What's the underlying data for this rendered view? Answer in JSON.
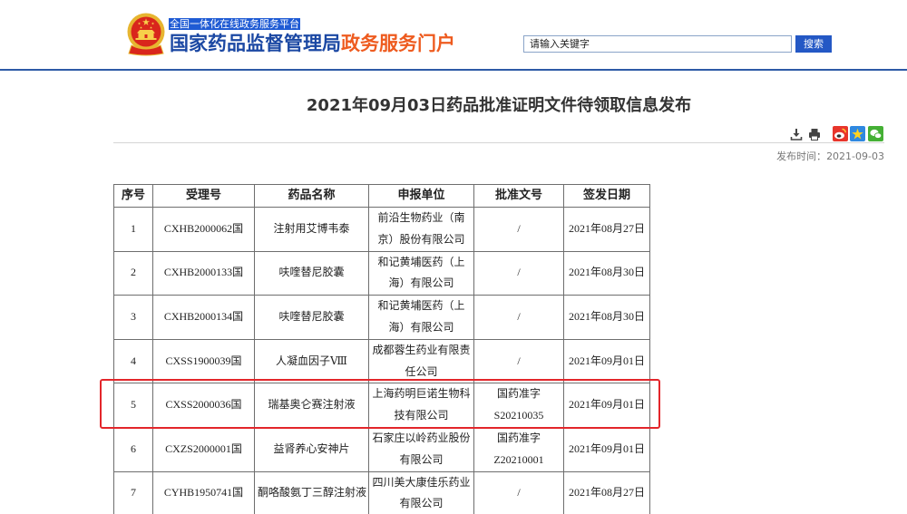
{
  "header": {
    "logo_icon": "national-emblem-icon",
    "platform_tag": "全国一体化在线政务服务平台",
    "title_main": "国家药品监督管理局",
    "title_suffix": "政务服务门户"
  },
  "search": {
    "placeholder": "请输入关键字",
    "button_label": "搜索"
  },
  "article": {
    "title": "2021年09月03日药品批准证明文件待领取信息发布",
    "tool_icons": [
      "download-icon",
      "print-icon"
    ],
    "share_icons": [
      "weibo-icon",
      "qzone-icon",
      "wechat-icon"
    ],
    "publish_time_label": "发布时间：",
    "publish_time": "2021-09-03"
  },
  "table": {
    "columns": [
      "序号",
      "受理号",
      "药品名称",
      "申报单位",
      "批准文号",
      "签发日期"
    ],
    "rows": [
      {
        "seq": "1",
        "acceptance_no": "CXHB2000062国",
        "drug_name": "注射用艾博韦泰",
        "applicant": "前沿生物药业（南京）股份有限公司",
        "approval_no": "/",
        "issue_date": "2021年08月27日"
      },
      {
        "seq": "2",
        "acceptance_no": "CXHB2000133国",
        "drug_name": "呋喹替尼胶囊",
        "applicant": "和记黄埔医药（上海）有限公司",
        "approval_no": "/",
        "issue_date": "2021年08月30日"
      },
      {
        "seq": "3",
        "acceptance_no": "CXHB2000134国",
        "drug_name": "呋喹替尼胶囊",
        "applicant": "和记黄埔医药（上海）有限公司",
        "approval_no": "/",
        "issue_date": "2021年08月30日"
      },
      {
        "seq": "4",
        "acceptance_no": "CXSS1900039国",
        "drug_name": "人凝血因子Ⅷ",
        "applicant": "成都蓉生药业有限责任公司",
        "approval_no": "/",
        "issue_date": "2021年09月01日"
      },
      {
        "seq": "5",
        "acceptance_no": "CXSS2000036国",
        "drug_name": "瑞基奥仑赛注射液",
        "applicant": "上海药明巨诺生物科技有限公司",
        "approval_no": "国药准字S20210035",
        "issue_date": "2021年09月01日"
      },
      {
        "seq": "6",
        "acceptance_no": "CXZS2000001国",
        "drug_name": "益肾养心安神片",
        "applicant": "石家庄以岭药业股份有限公司",
        "approval_no": "国药准字Z20210001",
        "issue_date": "2021年09月01日"
      },
      {
        "seq": "7",
        "acceptance_no": "CYHB1950741国",
        "drug_name": "酮咯酸氨丁三醇注射液",
        "applicant": "四川美大康佳乐药业有限公司",
        "approval_no": "/",
        "issue_date": "2021年08月27日"
      }
    ]
  },
  "colors": {
    "brand_blue": "#1b48a3",
    "accent_orange": "#ee5b1f",
    "platform_tag_bg": "#1f5bd4",
    "search_button_bg": "#2458c5",
    "header_rule": "#2d5aa6",
    "highlight_border": "#e3262b",
    "table_border": "#6e6e6e"
  }
}
